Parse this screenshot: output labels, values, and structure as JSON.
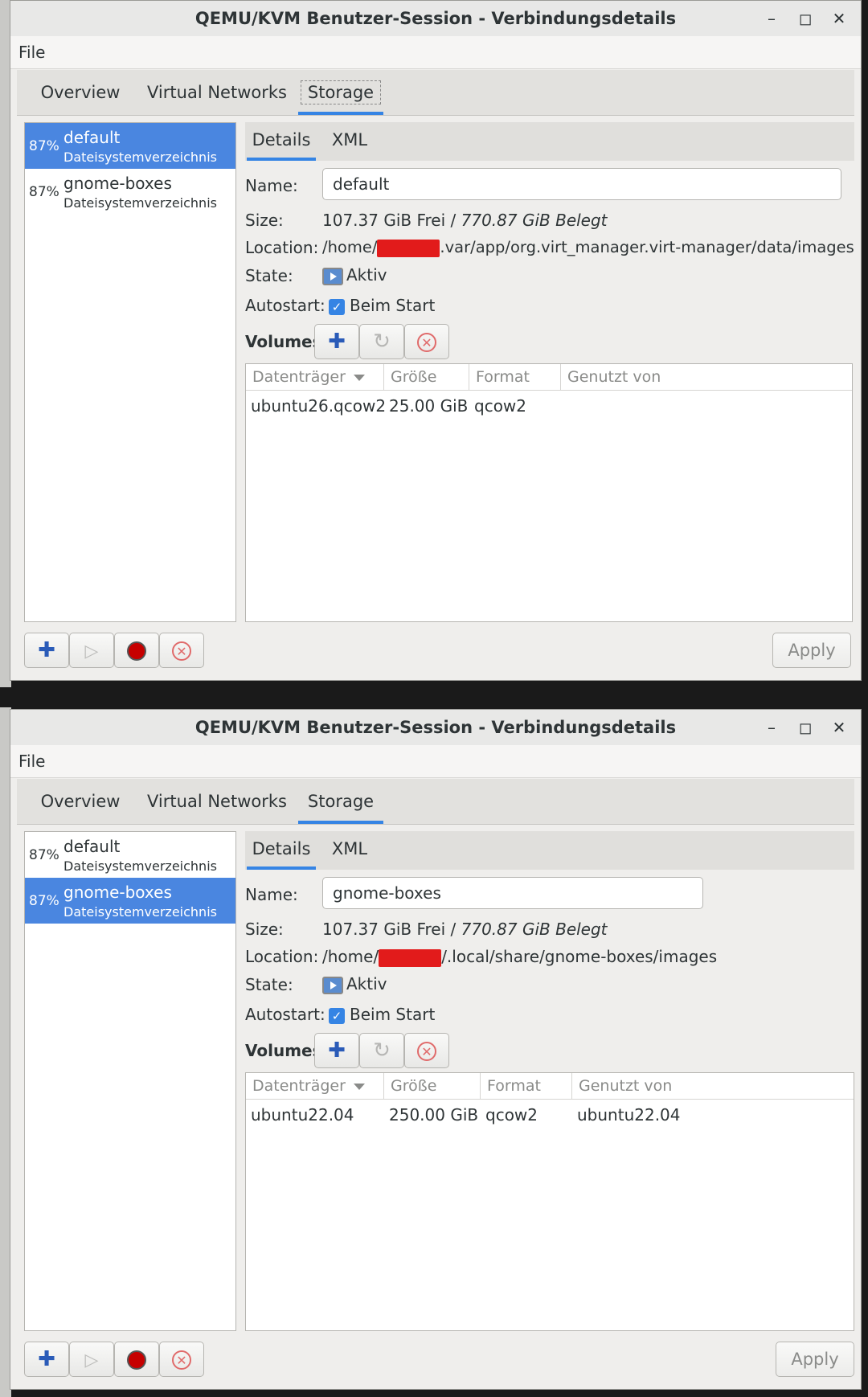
{
  "windows": [
    {
      "title": "QEMU/KVM Benutzer-Session - Verbindungsdetails",
      "menu": {
        "file": "File"
      },
      "tabs": [
        "Overview",
        "Virtual Networks",
        "Storage"
      ],
      "pools": [
        {
          "pct": "87%",
          "name": "default",
          "type": "Dateisystemverzeichnis"
        },
        {
          "pct": "87%",
          "name": "gnome-boxes",
          "type": "Dateisystemverzeichnis"
        }
      ],
      "subtabs": [
        "Details",
        "XML"
      ],
      "details": {
        "name_label": "Name:",
        "name_value": "default",
        "size_label": "Size:",
        "size_free": "107.37 GiB Frei / ",
        "size_used": "770.87 GiB Belegt",
        "location_label": "Location:",
        "location_prefix": "/home/",
        "location_suffix": ".var/app/org.virt_manager.virt-manager/data/images",
        "state_label": "State:",
        "state_value": "Aktiv",
        "autostart_label": "Autostart:",
        "autostart_value": "Beim Start",
        "volumes_label": "Volumes"
      },
      "volume_columns": [
        "Datenträger",
        "Größe",
        "Format",
        "Genutzt von"
      ],
      "volume_rows": [
        [
          "ubuntu26.qcow2",
          "25.00 GiB",
          "qcow2",
          ""
        ]
      ],
      "apply_label": "Apply"
    },
    {
      "title": "QEMU/KVM Benutzer-Session - Verbindungsdetails",
      "menu": {
        "file": "File"
      },
      "tabs": [
        "Overview",
        "Virtual Networks",
        "Storage"
      ],
      "pools": [
        {
          "pct": "87%",
          "name": "default",
          "type": "Dateisystemverzeichnis"
        },
        {
          "pct": "87%",
          "name": "gnome-boxes",
          "type": "Dateisystemverzeichnis"
        }
      ],
      "subtabs": [
        "Details",
        "XML"
      ],
      "details": {
        "name_label": "Name:",
        "name_value": "gnome-boxes",
        "size_label": "Size:",
        "size_free": "107.37 GiB Frei / ",
        "size_used": "770.87 GiB Belegt",
        "location_label": "Location:",
        "location_prefix": "/home/",
        "location_suffix": "/.local/share/gnome-boxes/images",
        "state_label": "State:",
        "state_value": "Aktiv",
        "autostart_label": "Autostart:",
        "autostart_value": "Beim Start",
        "volumes_label": "Volumes"
      },
      "volume_columns": [
        "Datenträger",
        "Größe",
        "Format",
        "Genutzt von"
      ],
      "volume_rows": [
        [
          "ubuntu22.04",
          "250.00 GiB",
          "qcow2",
          "ubuntu22.04"
        ]
      ],
      "apply_label": "Apply"
    }
  ]
}
